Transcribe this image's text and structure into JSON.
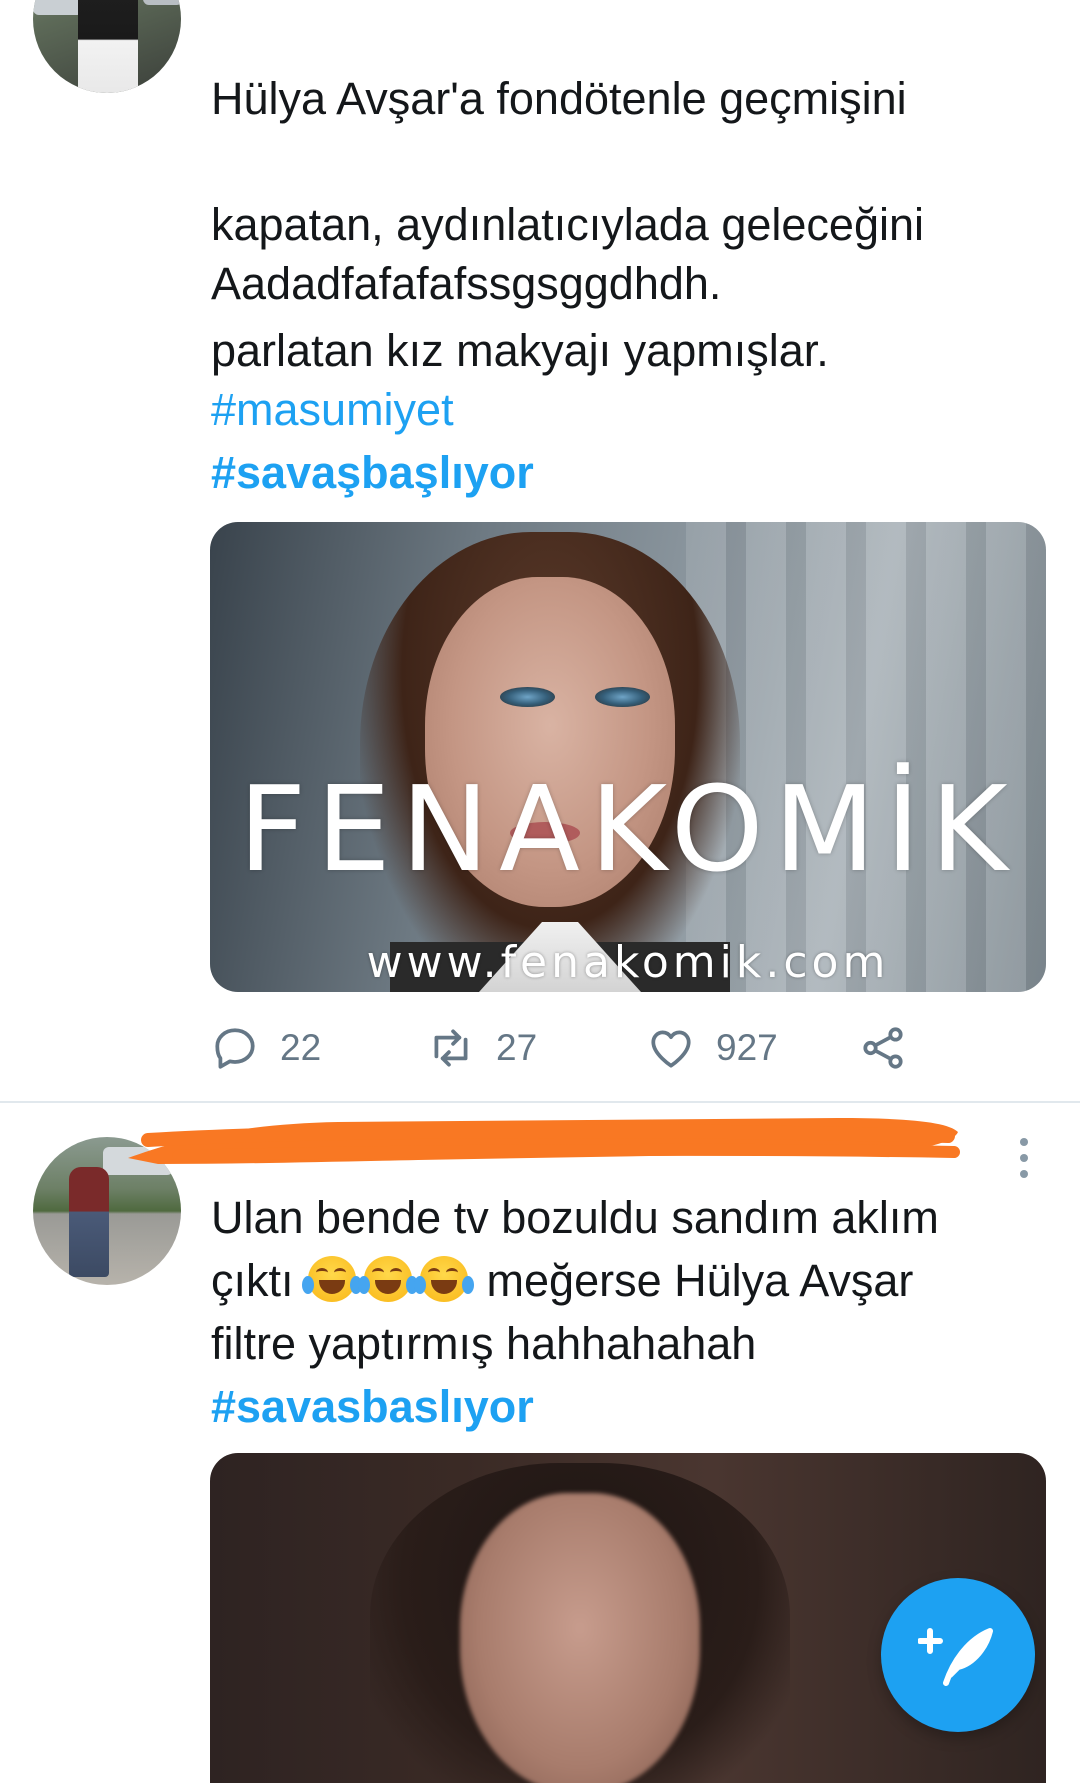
{
  "tweet1": {
    "text_line1": "Hülya Avşar'a fondötenle geçmişini",
    "text_line2": "kapatan, aydınlatıcıylada geleceğini",
    "text_line3": "parlatan kız makyajı yapmışlar.",
    "text_extra": "Aadadfafafafssgsggdhdh.",
    "hashtag1": "#masumiyet",
    "hashtag2": "#savaşbaşlıyor",
    "media": {
      "watermark_title": "FENAKOMİK",
      "watermark_url": "www.fenakomik.com"
    },
    "actions": {
      "replies": "22",
      "retweets": "27",
      "likes": "927"
    }
  },
  "tweet2": {
    "text_line1": "Ulan bende tv bozuldu sandım aklım",
    "text_line2_start": "çıktı",
    "text_line2_end": "meğerse Hülya Avşar",
    "text_line3": "filtre yaptırmış hahhahahah",
    "emoji": "face-with-tears-of-joy",
    "hashtag": "#savasbaslıyor"
  },
  "colors": {
    "accent": "#1da1f2",
    "text": "#14171a",
    "muted": "#657786",
    "divider": "#e1e8ed",
    "redaction": "#f97823"
  },
  "icons": {
    "reply": "reply-icon",
    "retweet": "retweet-icon",
    "like": "heart-icon",
    "share": "share-icon",
    "more": "more-vertical-icon",
    "compose": "compose-tweet-icon"
  }
}
